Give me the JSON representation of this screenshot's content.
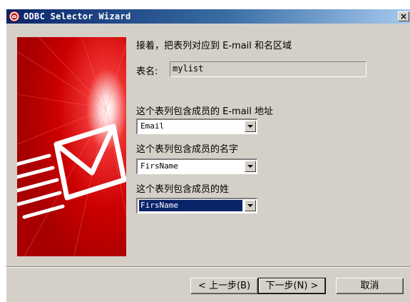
{
  "window": {
    "title": "ODBC Selector Wizard",
    "close_label": "×"
  },
  "form": {
    "heading": "接着，把表列对应到 E-mail 和名区域",
    "table_label": "表名:",
    "table_value": "mylist",
    "email_label": "这个表列包含成员的 E-mail 地址",
    "email_value": "Email",
    "firstname_label": "这个表列包含成员的名字",
    "firstname_value": "FirsName",
    "lastname_label": "这个表列包含成员的姓",
    "lastname_value": "FirsName"
  },
  "buttons": {
    "back": "< 上一步(B)",
    "next": "下一步(N) >",
    "cancel": "取消"
  },
  "colors": {
    "titlebar_start": "#0a246a",
    "titlebar_end": "#a6caf0",
    "panel_red": "#cc0000",
    "dialog_bg": "#d4d0c8"
  },
  "icons": {
    "app": "odbc-app-icon",
    "panel": "envelope-art"
  }
}
